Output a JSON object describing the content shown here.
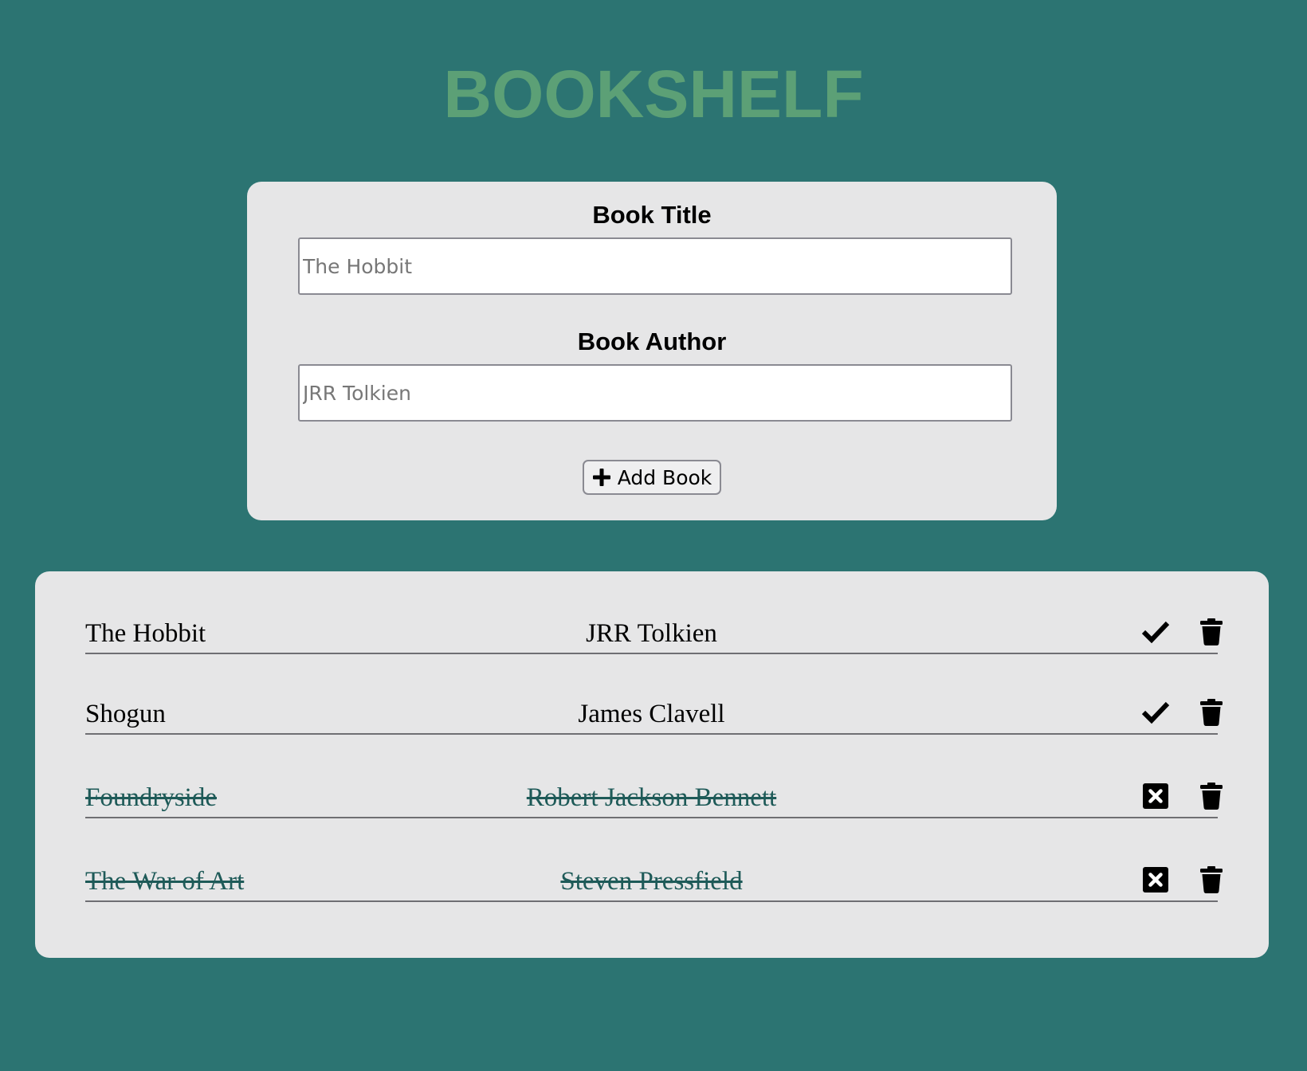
{
  "app": {
    "title": "BOOKSHELF",
    "colors": {
      "background": "#2c7472",
      "title": "#5ca076",
      "card": "#e6e6e7",
      "read_text": "#1e5a58"
    }
  },
  "form": {
    "title_label": "Book Title",
    "title_value": "",
    "title_placeholder": "The Hobbit",
    "author_label": "Book Author",
    "author_value": "",
    "author_placeholder": "JRR Tolkien",
    "add_button_label": "Add Book",
    "add_button_icon": "plus-icon"
  },
  "books": [
    {
      "title": "The Hobbit",
      "author": "JRR Tolkien",
      "read": false,
      "toggle_icon": "check-icon",
      "delete_icon": "trash-icon"
    },
    {
      "title": "Shogun",
      "author": "James Clavell",
      "read": false,
      "toggle_icon": "check-icon",
      "delete_icon": "trash-icon"
    },
    {
      "title": "Foundryside",
      "author": "Robert Jackson Bennett",
      "read": true,
      "toggle_icon": "x-square-icon",
      "delete_icon": "trash-icon"
    },
    {
      "title": "The War of Art",
      "author": "Steven Pressfield",
      "read": true,
      "toggle_icon": "x-square-icon",
      "delete_icon": "trash-icon"
    }
  ]
}
